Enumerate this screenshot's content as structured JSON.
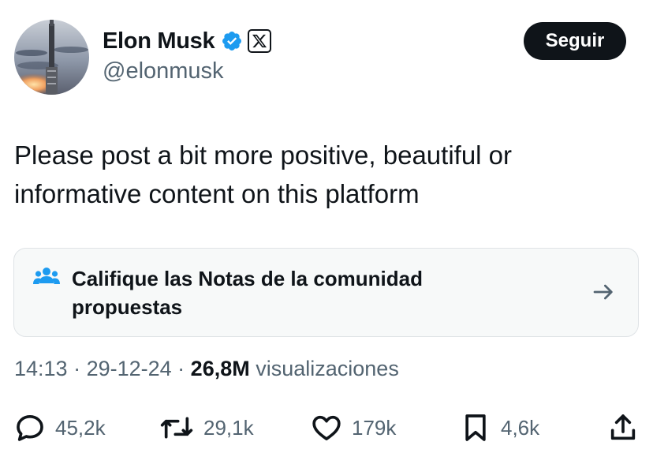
{
  "author": {
    "name": "Elon Musk",
    "handle": "@elonmusk",
    "verified": true,
    "affiliation_badge": "x-logo-icon"
  },
  "follow_button": {
    "label": "Seguir"
  },
  "tweet": {
    "lines": [
      "Please post a bit more positive, beautiful or",
      "informative content on this platform"
    ]
  },
  "community_note": {
    "icon": "people-icon",
    "lines": [
      "Califique las Notas de la comunidad",
      "propuestas"
    ]
  },
  "meta": {
    "time": "14:13",
    "separator": " · ",
    "date": "29-12-24",
    "views_count": "26,8M",
    "views_label": "visualizaciones"
  },
  "actions": {
    "replies": "45,2k",
    "reposts": "29,1k",
    "likes": "179k",
    "bookmarks": "4,6k"
  },
  "colors": {
    "text_primary": "#0f1419",
    "text_secondary": "#536471",
    "accent_blue": "#1d9bf0",
    "card_bg": "#f7f9f9"
  }
}
